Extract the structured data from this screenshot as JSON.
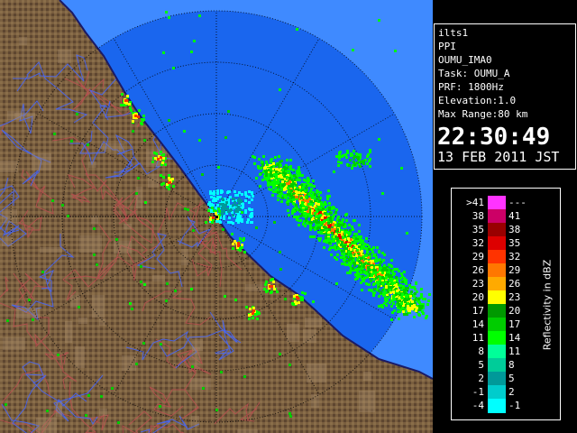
{
  "info": {
    "station": "ilts1",
    "scan_type": "PPI",
    "radar_id": "OUMU_IMA0",
    "task": "Task: OUMU_A",
    "prf": "PRF: 1800Hz",
    "elevation": "Elevation:1.0",
    "max_range": "Max Range:80 km",
    "time": "22:30:49",
    "date": "13 FEB 2011 JST"
  },
  "legend": {
    "unit": "Reflectivity in dBZ",
    "rows": [
      {
        "left": ">41",
        "right": "---",
        "color": "#ff33ff"
      },
      {
        "left": "38",
        "right": "41",
        "color": "#cc0066"
      },
      {
        "left": "35",
        "right": "38",
        "color": "#990000"
      },
      {
        "left": "32",
        "right": "35",
        "color": "#dd0000"
      },
      {
        "left": "29",
        "right": "32",
        "color": "#ff3300"
      },
      {
        "left": "26",
        "right": "29",
        "color": "#ff7700"
      },
      {
        "left": "23",
        "right": "26",
        "color": "#ffaa00"
      },
      {
        "left": "20",
        "right": "23",
        "color": "#ffff00"
      },
      {
        "left": "17",
        "right": "20",
        "color": "#009900"
      },
      {
        "left": "14",
        "right": "17",
        "color": "#00cc00"
      },
      {
        "left": "11",
        "right": "14",
        "color": "#00ff00"
      },
      {
        "left": "8",
        "right": "11",
        "color": "#00ff99"
      },
      {
        "left": "5",
        "right": "8",
        "color": "#00cc99"
      },
      {
        "left": "2",
        "right": "5",
        "color": "#009999"
      },
      {
        "left": "-1",
        "right": "2",
        "color": "#00cccc"
      },
      {
        "left": "-4",
        "right": "-1",
        "color": "#00ffff"
      }
    ]
  },
  "colors": {
    "sea": "#1a66ee",
    "outer_sea": "#3f8aff",
    "land": "#7a5f3f",
    "land_light": "#a9906c",
    "coast": "#1a1a66",
    "rivers": "#4466ff",
    "contours": "#b85050"
  }
}
